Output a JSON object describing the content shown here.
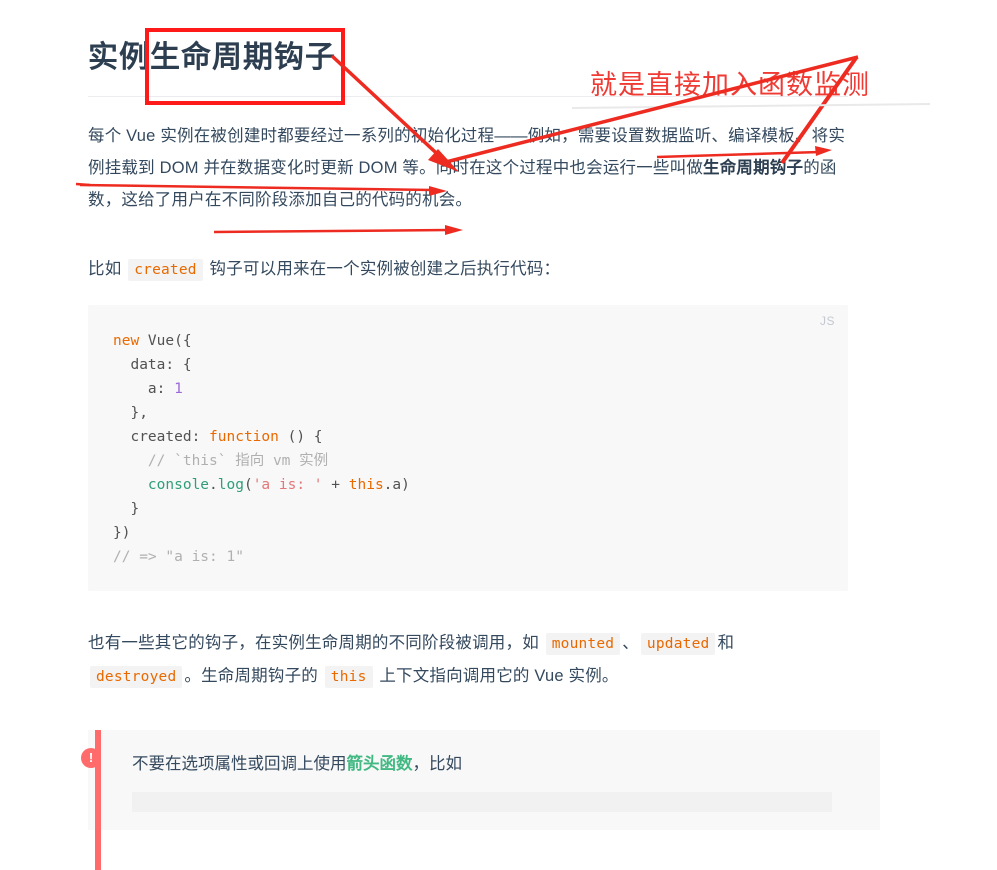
{
  "document": {
    "heading": "实例生命周期钩子",
    "paragraphs": {
      "intro_part1": "每个 Vue 实例在被创建时都要经过一系列的初始化过程——例如，需要设置数据监听、编译模板、将实例挂载到 DOM 并在数据变化时更新 DOM 等。同时在这个过程中也会运行一些叫做",
      "intro_strong": "生命周期钩子",
      "intro_part2": "的函数，这给了用户在不同阶段添加自己的代码的机会。",
      "created_part1": "比如",
      "created_code": "created",
      "created_part2": "钩子可以用来在一个实例被创建之后执行代码：",
      "other_part1": "也有一些其它的钩子，在实例生命周期的不同阶段被调用，如",
      "other_code_mounted": "mounted",
      "other_sep1": "、",
      "other_code_updated": "updated",
      "other_part2": "和",
      "other_code_destroyed": "destroyed",
      "other_part3": "。生命周期钩子的",
      "other_code_this": "this",
      "other_part4": "上下文指向调用它的 Vue 实例。"
    },
    "code_block": {
      "language_label": "JS",
      "lines": [
        {
          "tokens": [
            {
              "t": "new",
              "c": "tok-kw"
            },
            {
              "t": " Vue({",
              "c": "tok-pl"
            }
          ]
        },
        {
          "tokens": [
            {
              "t": "  data: {",
              "c": "tok-pl"
            }
          ]
        },
        {
          "tokens": [
            {
              "t": "    a: ",
              "c": "tok-pl"
            },
            {
              "t": "1",
              "c": "tok-num"
            }
          ]
        },
        {
          "tokens": [
            {
              "t": "  },",
              "c": "tok-pl"
            }
          ]
        },
        {
          "tokens": [
            {
              "t": "  created: ",
              "c": "tok-pl"
            },
            {
              "t": "function",
              "c": "tok-kw"
            },
            {
              "t": " () {",
              "c": "tok-pl"
            }
          ]
        },
        {
          "tokens": [
            {
              "t": "    // `this` 指向 vm 实例",
              "c": "tok-cmt"
            }
          ]
        },
        {
          "tokens": [
            {
              "t": "    console",
              "c": "tok-fn"
            },
            {
              "t": ".",
              "c": "tok-pl"
            },
            {
              "t": "log",
              "c": "tok-fn"
            },
            {
              "t": "(",
              "c": "tok-pl"
            },
            {
              "t": "'a is: '",
              "c": "tok-str"
            },
            {
              "t": " + ",
              "c": "tok-pl"
            },
            {
              "t": "this",
              "c": "tok-this"
            },
            {
              "t": ".a)",
              "c": "tok-pl"
            }
          ]
        },
        {
          "tokens": [
            {
              "t": "  }",
              "c": "tok-pl"
            }
          ]
        },
        {
          "tokens": [
            {
              "t": "})",
              "c": "tok-pl"
            }
          ]
        },
        {
          "tokens": [
            {
              "t": "// => \"a is: 1\"",
              "c": "tok-cmt"
            }
          ]
        }
      ]
    },
    "tip": {
      "badge": "!",
      "text_part1": "不要在选项属性或回调上使用",
      "link": "箭头函数",
      "text_part2": "，比如"
    }
  },
  "annotations": {
    "note_text": "就是直接加入函数监测",
    "color": "#f03a34",
    "box_color": "#ff1a1a"
  },
  "colors": {
    "text": "#34495e",
    "heading": "#2c3e50",
    "inline_code": "#e96900",
    "link_green": "#42b983",
    "tip_red": "#ff6a6a",
    "code_bg": "#f8f8f8",
    "rule": "#eaecef"
  }
}
